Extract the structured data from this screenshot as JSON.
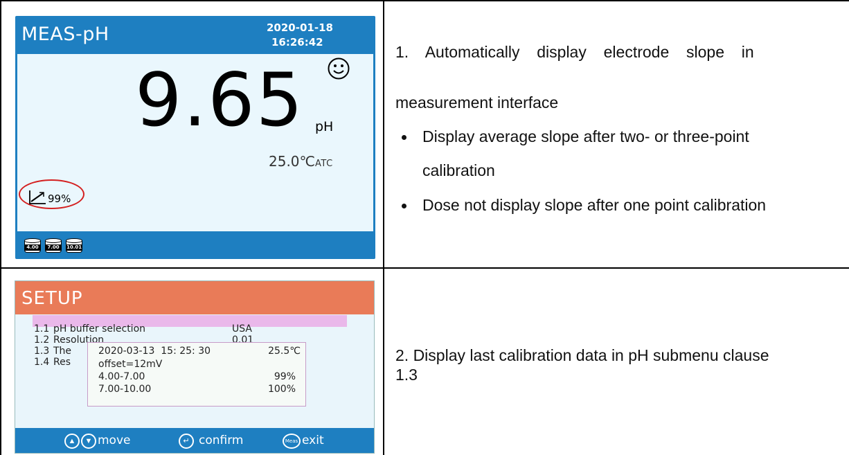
{
  "meas_screen": {
    "title": "MEAS-pH",
    "date": "2020-01-18",
    "time": "16:26:42",
    "value": "9.65",
    "unit": "pH",
    "temperature": "25.0℃",
    "temperature_mode": "ATC",
    "slope": "99%",
    "buffers": [
      "4.00",
      "7.00",
      "10.01"
    ],
    "icons": [
      "smiley-icon",
      "slope-icon",
      "buffer-bottle-icon"
    ]
  },
  "setup_screen": {
    "title": "SETUP",
    "menu": [
      {
        "num": "1.1",
        "label": "pH buffer selection",
        "value": "USA"
      },
      {
        "num": "1.2",
        "label": "Resolution",
        "value": "0.01"
      },
      {
        "num": "1.3",
        "label": "The",
        "value": ""
      },
      {
        "num": "1.4",
        "label": "Res",
        "value": ""
      }
    ],
    "popup": {
      "timestamp": "2020-03-13  15: 25: 30",
      "temperature": "25.5℃",
      "offset": "offset=12mV",
      "rows": [
        {
          "range": "4.00-7.00",
          "slope": "99%"
        },
        {
          "range": "7.00-10.00",
          "slope": "100%"
        }
      ]
    },
    "footer": {
      "move_label": "move",
      "confirm_label": "confirm",
      "exit_label": "exit",
      "meas_key_label": "Meas"
    },
    "colors": {
      "header": "#e97b58",
      "footer": "#1e7fc1",
      "highlight": "#eab8ea"
    }
  },
  "text": {
    "item1_heading_line1": "1.  Automatically  display  electrode  slope  in",
    "item1_heading_line2": "measurement interface",
    "item1_bullet1_line1": "Display average slope after two- or three-point",
    "item1_bullet1_line2": "calibration",
    "item1_bullet2": "Dose not display slope after one point calibration",
    "item2_line1": "2. Display last calibration data in pH submenu clause",
    "item2_line2": "1.3"
  }
}
